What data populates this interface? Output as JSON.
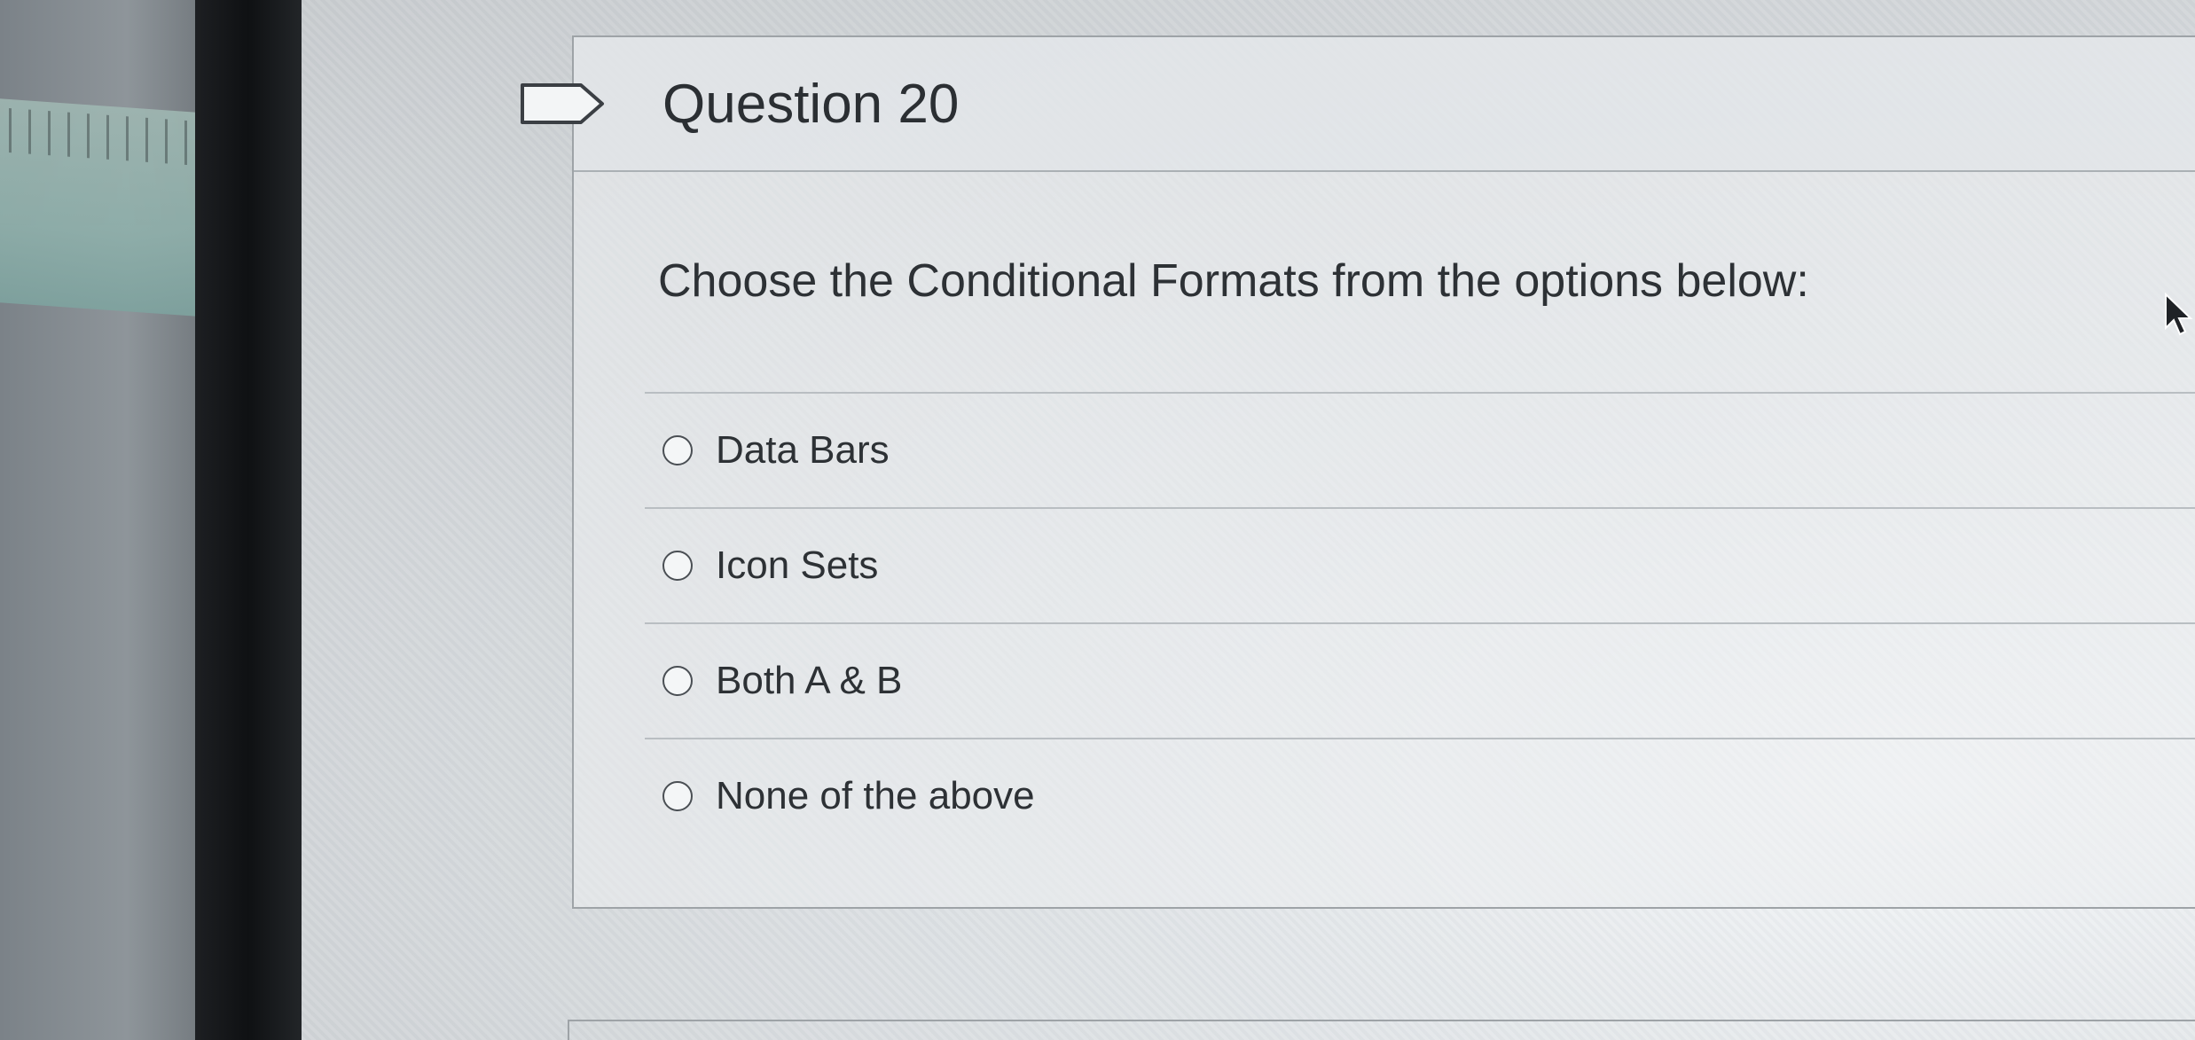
{
  "question": {
    "title": "Question 20",
    "text": "Choose the Conditional Formats from the options below:",
    "options": [
      {
        "label": "Data Bars"
      },
      {
        "label": "Icon Sets"
      },
      {
        "label": "Both A & B"
      },
      {
        "label": "None of the above"
      }
    ]
  },
  "icons": {
    "flag": "flag-question-icon",
    "cursor": "mouse-pointer-icon",
    "radio": "radio-unselected-icon"
  },
  "colors": {
    "text": "#2d3135",
    "border": "#9ea3a7"
  }
}
